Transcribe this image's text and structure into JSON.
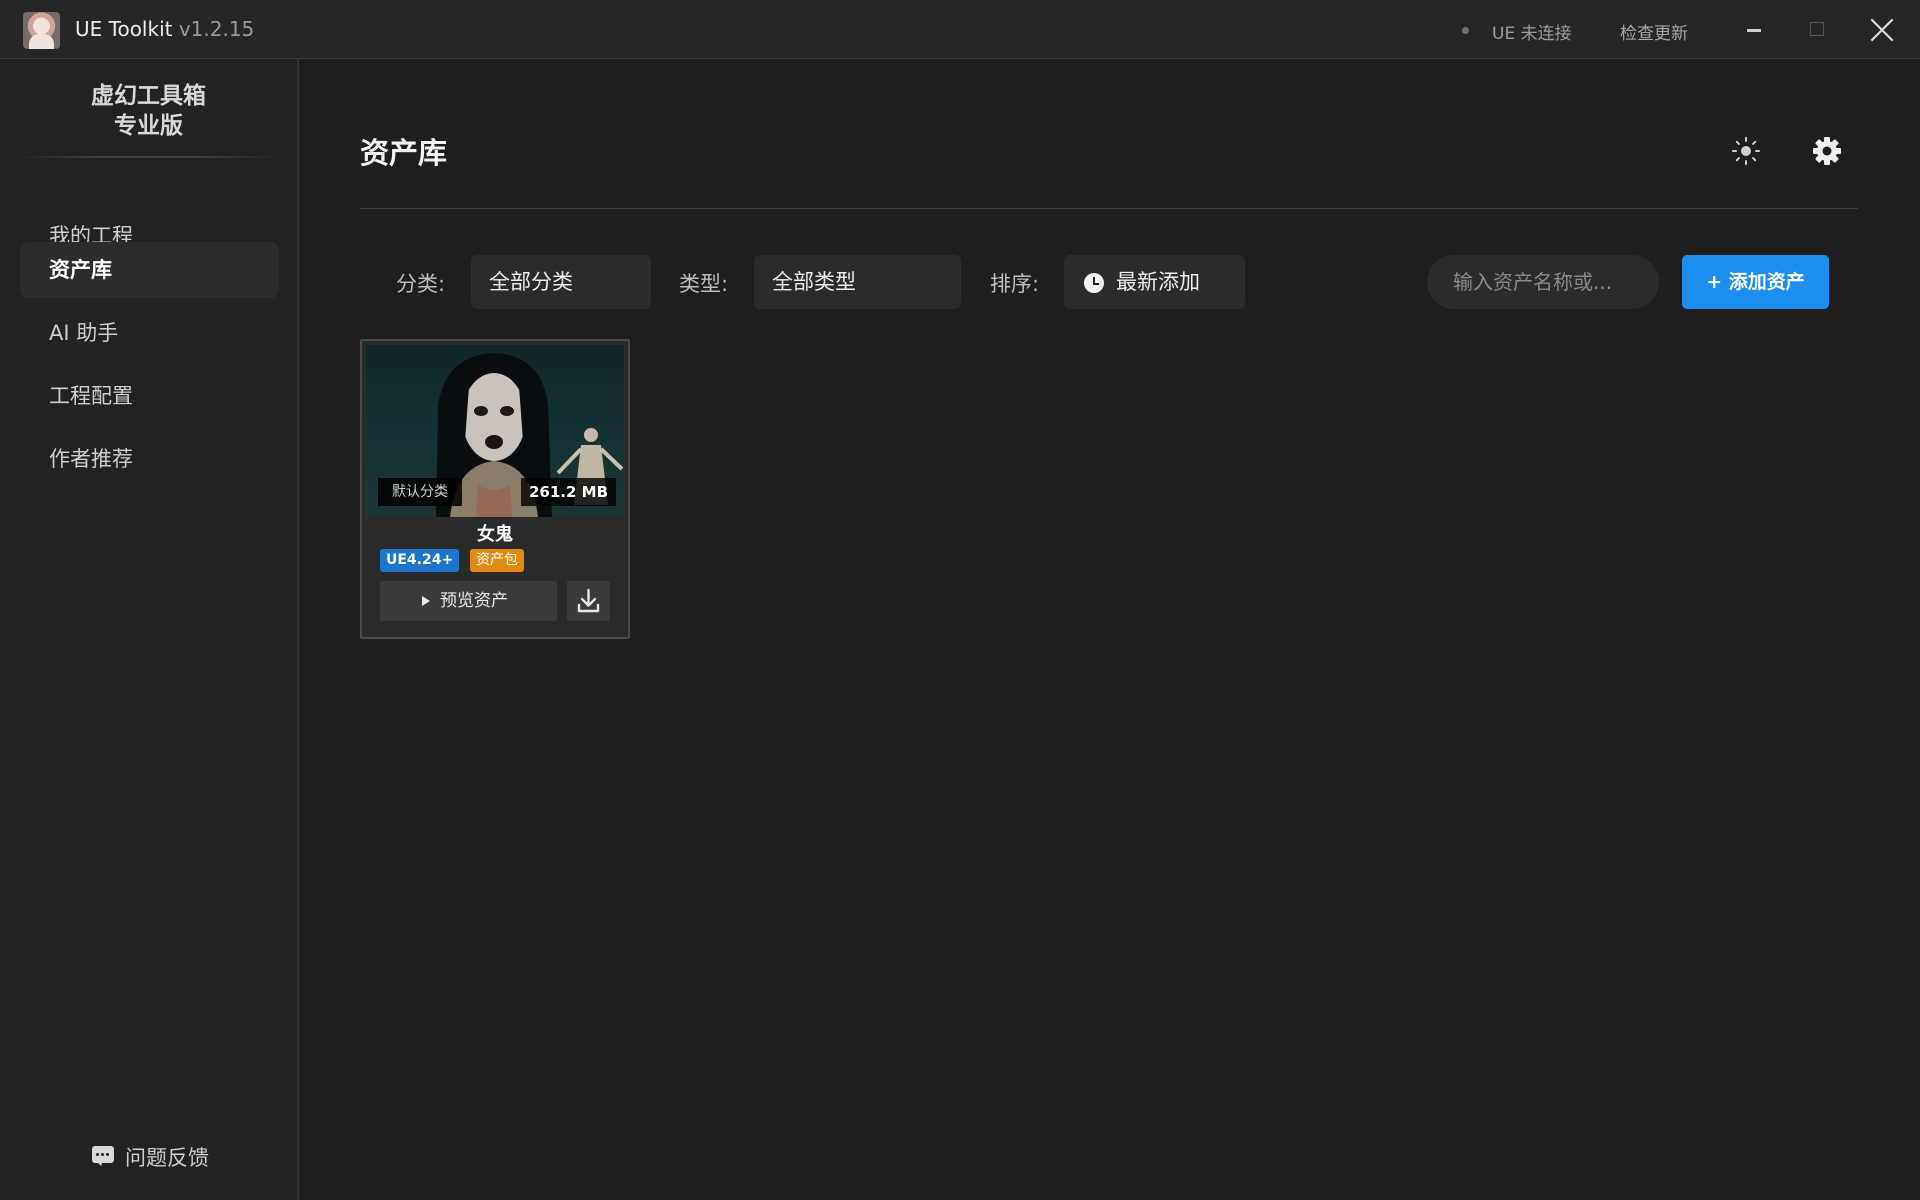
{
  "app": {
    "name": "UE Toolkit",
    "version": "v1.2.15",
    "status": "UE 未连接",
    "check_update": "检查更新"
  },
  "sidebar": {
    "brand_line1": "虚幻工具箱",
    "brand_line2": "专业版",
    "items": [
      {
        "label": "我的工程",
        "active": false
      },
      {
        "label": "资产库",
        "active": true
      },
      {
        "label": "AI 助手",
        "active": false
      },
      {
        "label": "工程配置",
        "active": false
      },
      {
        "label": "作者推荐",
        "active": false
      }
    ],
    "feedback": "问题反馈"
  },
  "main": {
    "title": "资产库",
    "filters": {
      "category_label": "分类:",
      "category_value": "全部分类",
      "type_label": "类型:",
      "type_value": "全部类型",
      "sort_label": "排序:",
      "sort_value": "最新添加"
    },
    "search": {
      "placeholder": "输入资产名称或..."
    },
    "add_button": "+ 添加资产",
    "assets": [
      {
        "name": "女鬼",
        "category": "默认分类",
        "size": "261.2 MB",
        "version_badge": "UE4.24+",
        "type_badge": "资产包",
        "preview_label": "预览资产"
      }
    ]
  },
  "colors": {
    "accent": "#1e8df0",
    "badge_ue": "#1d74c9",
    "badge_pack": "#e08b12",
    "background": "#1e1e1e",
    "sidebar": "#222222"
  },
  "icons": [
    "app-logo",
    "sun-icon",
    "gear-icon",
    "clock-icon",
    "play-icon",
    "download-icon",
    "chat-icon",
    "close-icon",
    "minimize-icon",
    "maximize-icon"
  ]
}
